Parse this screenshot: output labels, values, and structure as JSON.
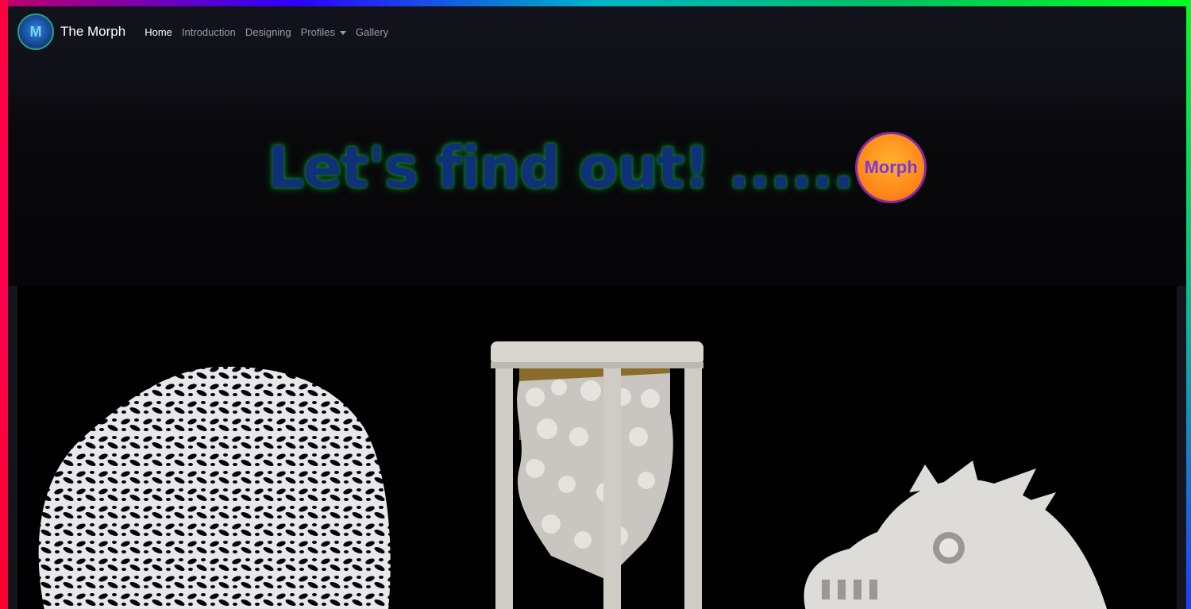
{
  "nav": {
    "brand_logo_letter": "M",
    "brand_name": "The Morph",
    "links": [
      {
        "label": "Home",
        "active": true
      },
      {
        "label": "Introduction",
        "active": false
      },
      {
        "label": "Designing",
        "active": false
      },
      {
        "label": "Profiles",
        "active": false,
        "dropdown": true
      },
      {
        "label": "Gallery",
        "active": false
      }
    ]
  },
  "hero": {
    "headline": "Let's find out! ......",
    "badge_label": "Morph"
  },
  "colors": {
    "headline": "#10307a",
    "headline_glow": "#0f7a2a",
    "badge_fill": "#ff8a1a",
    "badge_text": "#7a3ad8",
    "badge_ring": "#8a2aa0"
  },
  "showcase": {
    "images": [
      "lattice-sculpture",
      "column-cage-sculpture",
      "dragon-head-sculpture"
    ]
  }
}
